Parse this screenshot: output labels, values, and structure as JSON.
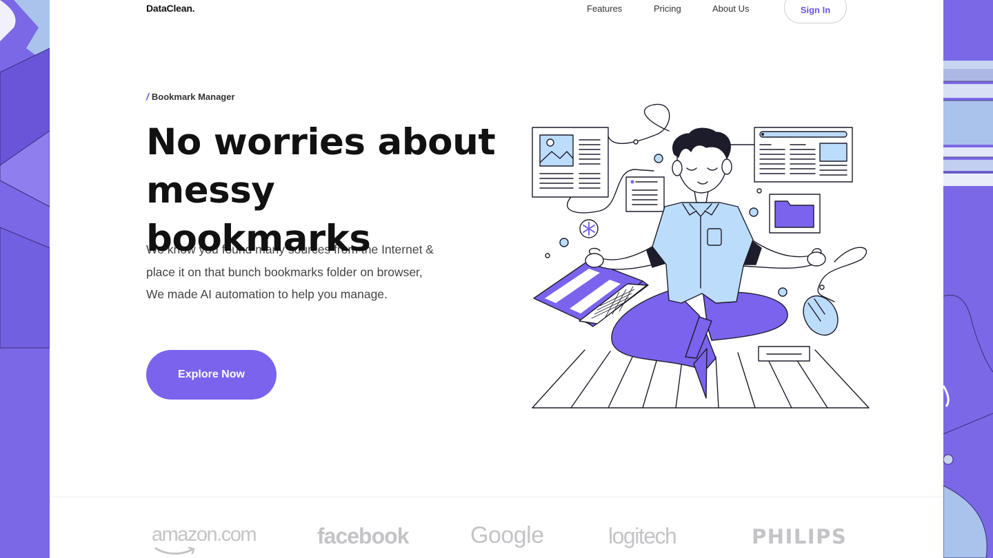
{
  "nav": {
    "brand": "DataClean.",
    "links": [
      "Features",
      "Pricing",
      "About Us"
    ],
    "signin": "Sign In"
  },
  "hero": {
    "eyebrow_mark": "/",
    "eyebrow": "Bookmark Manager",
    "headline_line1": "No worries about",
    "headline_line2": "messy bookmarks",
    "description_lines": [
      "We know you found many sources from the Internet &",
      "place it on that bunch bookmarks folder on browser,",
      "We made AI automation to help you manage."
    ],
    "cta": "Explore Now"
  },
  "brands": [
    "amazon.com",
    "facebook",
    "Google",
    "logitech",
    "PHILIPS"
  ],
  "colors": {
    "accent": "#7b63ee",
    "background_frame": "#7b68e6",
    "highlight": "#dcedfd",
    "shirt": "#bcdcfb"
  },
  "icons": [
    "bookmark-mark-icon",
    "meditation-illustration",
    "amazon-smile-icon"
  ]
}
